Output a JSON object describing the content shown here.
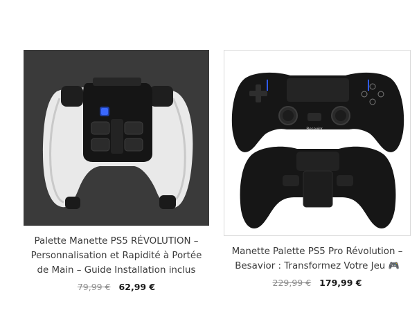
{
  "products": [
    {
      "title": "Palette Manette PS5 RÉVOLUTION – Personnalisation et Rapidité à Portée de Main – Guide Installation inclus",
      "old_price": "79,99 €",
      "new_price": "62,99 €",
      "image_icon": "white-ps5-controller-with-back-paddle-attachment"
    },
    {
      "title": "Manette Palette PS5 Pro Révolution – Besavior : Transformez Votre Jeu",
      "title_emoji": "🎮",
      "old_price": "229,99 €",
      "new_price": "179,99 €",
      "image_icon": "black-ps5-controller-front-and-back-views",
      "image_brand_text": "Besavior"
    }
  ]
}
